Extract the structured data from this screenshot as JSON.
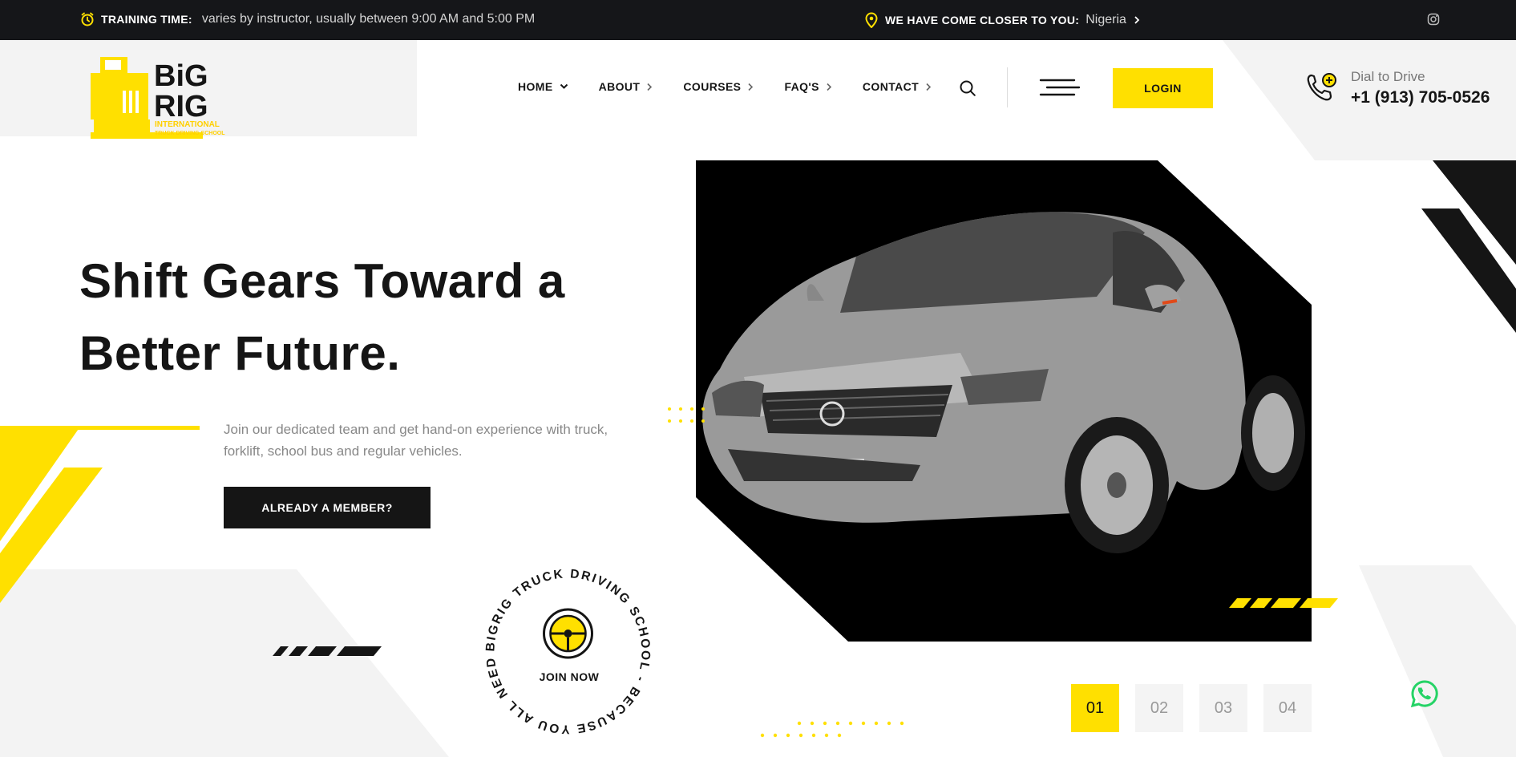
{
  "topbar": {
    "training_label": "TRAINING TIME:",
    "training_value": "varies by instructor, usually between 9:00 AM and 5:00 PM",
    "location_label": "WE HAVE COME CLOSER TO YOU:",
    "location_value": "Nigeria"
  },
  "logo": {
    "line1": "BiG",
    "line2": "RIG",
    "line3": "INTERNATIONAL",
    "line4": "TRUCK DRIVING SCHOOL"
  },
  "nav": {
    "items": [
      {
        "label": "HOME",
        "icon": "chevron-down-icon"
      },
      {
        "label": "ABOUT",
        "icon": "chevron-right-icon"
      },
      {
        "label": "COURSES",
        "icon": "chevron-right-icon"
      },
      {
        "label": "FAQ'S",
        "icon": "chevron-right-icon"
      },
      {
        "label": "CONTACT",
        "icon": "chevron-right-icon"
      }
    ],
    "login_label": "LOGIN"
  },
  "dial": {
    "label": "Dial to Drive",
    "phone": "+1 (913) 705-0526"
  },
  "hero": {
    "title_line1": "Shift Gears Toward a",
    "title_line2": "Better Future.",
    "description": "Join our dedicated team and get hand-on experience with truck, forklift, school bus and regular vehicles.",
    "member_button": "ALREADY A MEMBER?"
  },
  "badge": {
    "ring_text": "BIGRIG TRUCK DRIVING SCHOOL - BECAUSE YOU ALL NEED IT - ",
    "join_label": "JOIN NOW"
  },
  "pager": {
    "pages": [
      "01",
      "02",
      "03",
      "04"
    ],
    "active": "01"
  },
  "colors": {
    "accent": "#ffe000",
    "dark": "#151515",
    "topbar": "#151619",
    "whatsapp": "#25d366"
  }
}
